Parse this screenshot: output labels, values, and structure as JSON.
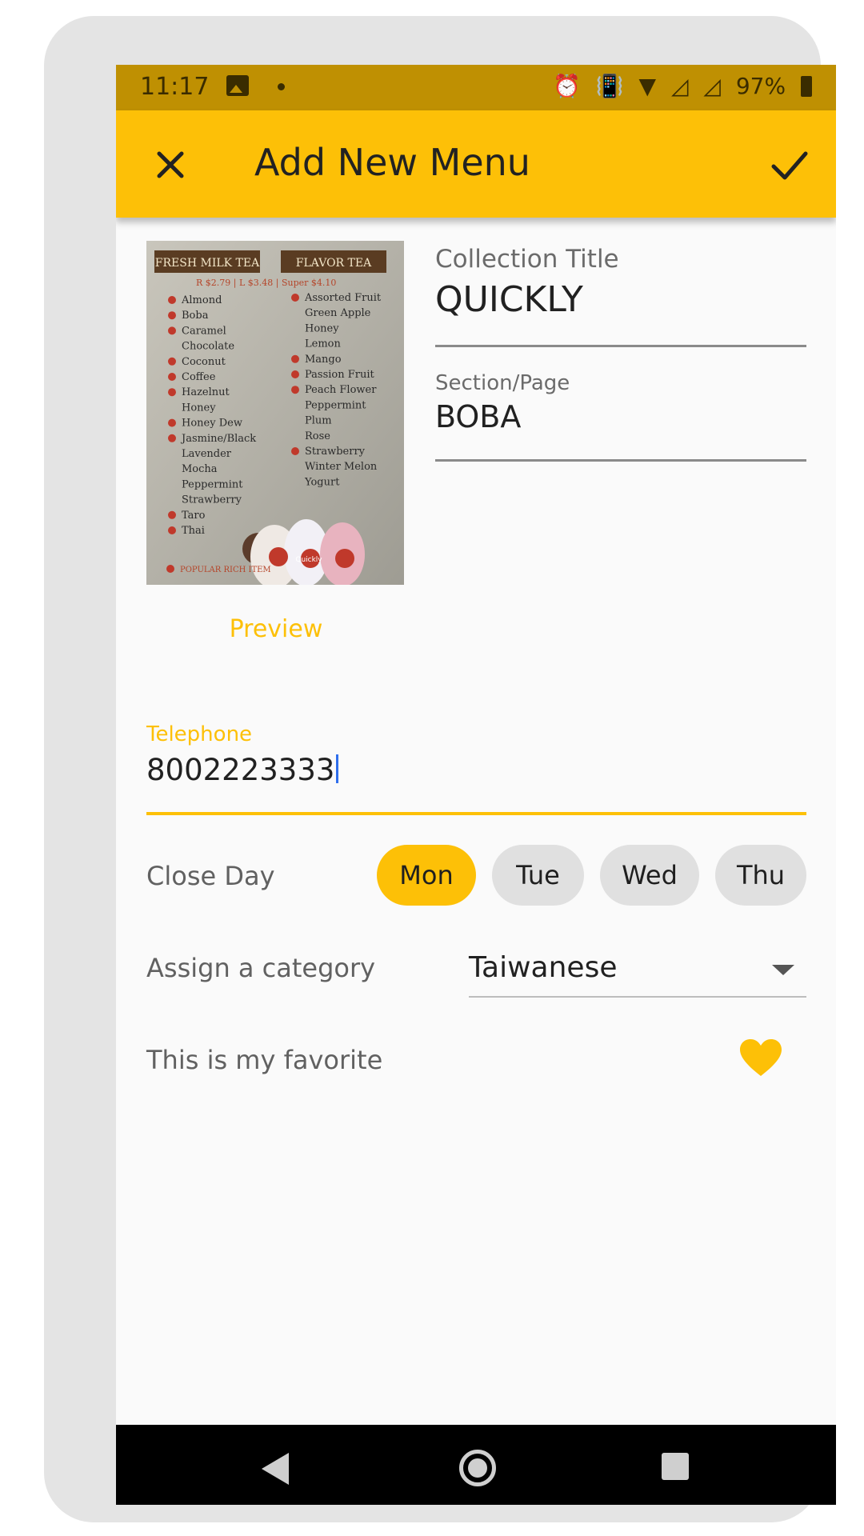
{
  "status_bar": {
    "time": "11:17",
    "battery": "97%",
    "icons": [
      "image-icon",
      "alarm-icon",
      "vibrate-icon",
      "wifi-icon",
      "signal-icon",
      "signal-icon",
      "battery-icon"
    ]
  },
  "app_bar": {
    "title": "Add New Menu",
    "close_icon": "close-icon",
    "confirm_icon": "check-icon"
  },
  "menu_photo": {
    "headers": [
      "FRESH MILK TEA",
      "FLAVOR TEA"
    ],
    "price_line": "R $2.79 | L $3.48 | Super $4.10",
    "milk_tea_items": [
      "Almond",
      "Boba",
      "Caramel",
      "Chocolate",
      "Coconut",
      "Coffee",
      "Hazelnut",
      "Honey",
      "Honey Dew",
      "Jasmine/Black",
      "Lavender",
      "Mocha",
      "Peppermint",
      "Strawberry",
      "Taro",
      "Thai"
    ],
    "flavor_tea_items": [
      "Assorted Fruit",
      "Green Apple",
      "Honey",
      "Lemon",
      "Mango",
      "Passion Fruit",
      "Peach Flower",
      "Peppermint",
      "Plum",
      "Rose",
      "Strawberry",
      "Winter Melon",
      "Yogurt"
    ],
    "footer": "POPULAR RICH ITEM",
    "cup_brand": "Quickly"
  },
  "preview_label": "Preview",
  "collection_title": {
    "label": "Collection Title",
    "value": "QUICKLY"
  },
  "section_page": {
    "label": "Section/Page",
    "value": "BOBA"
  },
  "telephone": {
    "label": "Telephone",
    "value": "8002223333"
  },
  "close_day": {
    "label": "Close Day",
    "days": [
      "Mon",
      "Tue",
      "Wed",
      "Thu"
    ],
    "selected": "Mon"
  },
  "category": {
    "label": "Assign a category",
    "value": "Taiwanese"
  },
  "favorite": {
    "label": "This is my favorite",
    "icon": "heart-icon"
  },
  "colors": {
    "accent": "#fdc007",
    "status_bar": "#bf9002",
    "chip_unselected": "#e0e0e0"
  }
}
